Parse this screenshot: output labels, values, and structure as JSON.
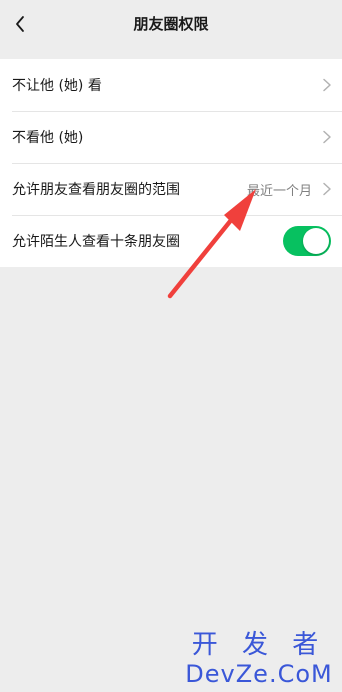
{
  "header": {
    "title": "朋友圈权限",
    "back_icon": "chevron-left-icon"
  },
  "settings": {
    "rows": [
      {
        "label": "不让他 (她) 看",
        "icon": "chevron-right-icon"
      },
      {
        "label": "不看他 (她)",
        "icon": "chevron-right-icon"
      },
      {
        "label": "允许朋友查看朋友圈的范围",
        "value": "最近一个月",
        "icon": "chevron-right-icon"
      },
      {
        "label": "允许陌生人查看十条朋友圈",
        "toggle_on": true
      }
    ]
  },
  "annotation": {
    "color": "#f0403c"
  },
  "watermark": {
    "cn": "开 发 者",
    "en": "DevZe.CoM"
  },
  "colors": {
    "background": "#ededed",
    "accent": "#07c160",
    "watermark": "#3a57d8"
  }
}
